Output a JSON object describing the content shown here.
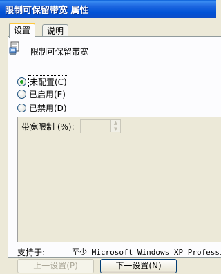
{
  "window": {
    "title": "限制可保留带宽 属性"
  },
  "tabs": [
    {
      "label": "设置",
      "active": true
    },
    {
      "label": "说明",
      "active": false
    }
  ],
  "policy": {
    "name": "限制可保留带宽",
    "icon": "policy-setting-icon"
  },
  "options": [
    {
      "label": "未配置(C)",
      "selected": true
    },
    {
      "label": "已启用(E)",
      "selected": false
    },
    {
      "label": "已禁用(D)",
      "selected": false
    }
  ],
  "bandwidth": {
    "label": "带宽限制 (%):",
    "value": ""
  },
  "supported": {
    "label": "支持于:",
    "value": "至少 Microsoft Windows XP Professio"
  },
  "buttons": {
    "prev": "上一设置(P)",
    "next": "下一设置(N)"
  },
  "colors": {
    "title_bar": "#0052d6",
    "dialog_bg": "#ece9d8",
    "radio_selected": "#21a121",
    "tab_highlight": "#ffc83c"
  }
}
